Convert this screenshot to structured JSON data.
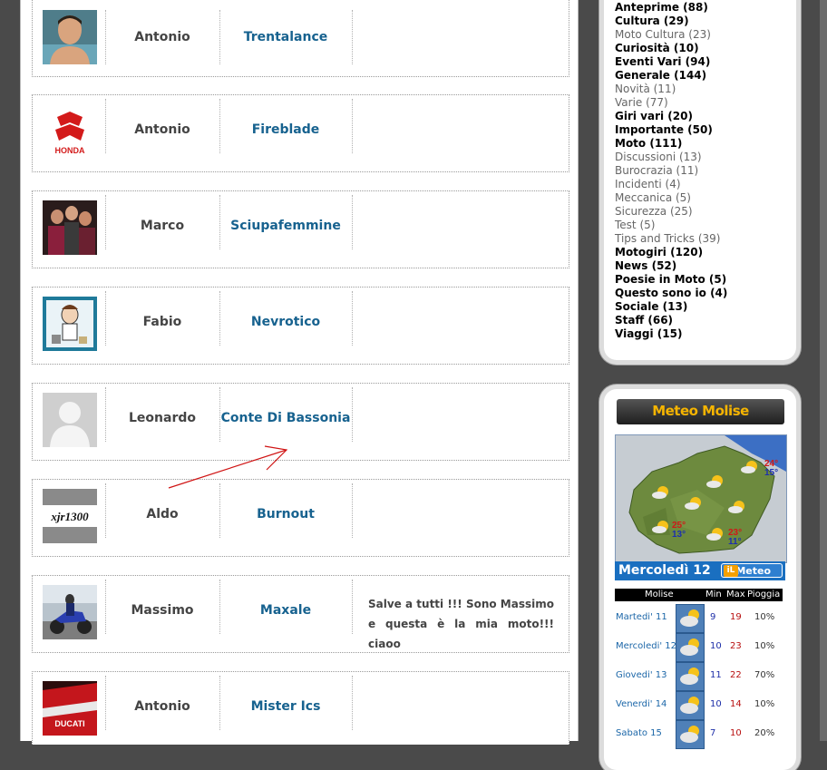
{
  "members": [
    {
      "name": "Antonio",
      "nickname": "Trentalance",
      "message": "",
      "avatar_icon": "person-photo-icon"
    },
    {
      "name": "Antonio",
      "nickname": "Fireblade",
      "message": "",
      "avatar_icon": "honda-logo-icon",
      "avatar_text": "HONDA"
    },
    {
      "name": "Marco",
      "nickname": "Sciupafemmine",
      "message": "",
      "avatar_icon": "group-photo-icon"
    },
    {
      "name": "Fabio",
      "nickname": "Nevrotico",
      "message": "",
      "avatar_icon": "cartoon-avatar-icon"
    },
    {
      "name": "Leonardo",
      "nickname": "Conte Di Bassonia",
      "message": "",
      "avatar_icon": "default-avatar-icon"
    },
    {
      "name": "Aldo",
      "nickname": "Burnout",
      "message": "",
      "avatar_icon": "xjr-logo-icon",
      "avatar_text": "xjr1300"
    },
    {
      "name": "Massimo",
      "nickname": "Maxale",
      "message": "Salve a tutti !!! Sono Massimo e questa è la mia moto!!! ciaoo",
      "avatar_icon": "motorcycle-photo-icon"
    },
    {
      "name": "Antonio",
      "nickname": "Mister Ics",
      "message": "",
      "avatar_icon": "ducati-photo-icon",
      "avatar_text": "DUCATI"
    }
  ],
  "categories": [
    {
      "label": "Anteprime (88)",
      "level": "main"
    },
    {
      "label": "Cultura (29)",
      "level": "main"
    },
    {
      "label": "Moto Cultura (23)",
      "level": "sub"
    },
    {
      "label": "Curiosità (10)",
      "level": "main"
    },
    {
      "label": "Eventi Vari (94)",
      "level": "main"
    },
    {
      "label": "Generale (144)",
      "level": "main"
    },
    {
      "label": "Novità (11)",
      "level": "sub"
    },
    {
      "label": "Varie (77)",
      "level": "sub"
    },
    {
      "label": "Giri vari (20)",
      "level": "main"
    },
    {
      "label": "Importante (50)",
      "level": "main"
    },
    {
      "label": "Moto (111)",
      "level": "main"
    },
    {
      "label": "Discussioni (13)",
      "level": "sub"
    },
    {
      "label": "Burocrazia (11)",
      "level": "sub"
    },
    {
      "label": "Incidenti (4)",
      "level": "sub"
    },
    {
      "label": "Meccanica (5)",
      "level": "sub"
    },
    {
      "label": "Sicurezza (25)",
      "level": "sub"
    },
    {
      "label": "Test (5)",
      "level": "sub"
    },
    {
      "label": "Tips and Tricks (39)",
      "level": "sub"
    },
    {
      "label": "Motogiri (120)",
      "level": "main"
    },
    {
      "label": "News (52)",
      "level": "main"
    },
    {
      "label": "Poesie in Moto (5)",
      "level": "main"
    },
    {
      "label": "Questo sono io (4)",
      "level": "main"
    },
    {
      "label": "Sociale (13)",
      "level": "main"
    },
    {
      "label": "Staff (66)",
      "level": "main"
    },
    {
      "label": "Viaggi (15)",
      "level": "main"
    }
  ],
  "meteo": {
    "title": "Meteo Molise",
    "date_label": "Mercoledì 12",
    "logo_prefix": "iL",
    "logo_text": "Meteo",
    "map_temps": [
      {
        "max": "24°",
        "min": "15°"
      },
      {
        "max": "25°",
        "min": "13°"
      },
      {
        "max": "23°",
        "min": "11°"
      }
    ],
    "table_headers": {
      "region": "Molise",
      "min": "Min",
      "max": "Max",
      "rain": "Pioggia"
    },
    "forecast": [
      {
        "day": "Martedi' 11",
        "min": "9",
        "max": "19",
        "rain": "10%"
      },
      {
        "day": "Mercoledi' 12",
        "min": "10",
        "max": "23",
        "rain": "10%"
      },
      {
        "day": "Giovedi' 13",
        "min": "11",
        "max": "22",
        "rain": "70%"
      },
      {
        "day": "Venerdi' 14",
        "min": "10",
        "max": "14",
        "rain": "10%"
      },
      {
        "day": "Sabato 15",
        "min": "7",
        "max": "10",
        "rain": "20%"
      }
    ]
  },
  "colors": {
    "nickname": "#17628f",
    "page_bg": "#4a4a4a",
    "meteo_title": "#f5b400",
    "meteo_bar": "#1a6fc0"
  }
}
